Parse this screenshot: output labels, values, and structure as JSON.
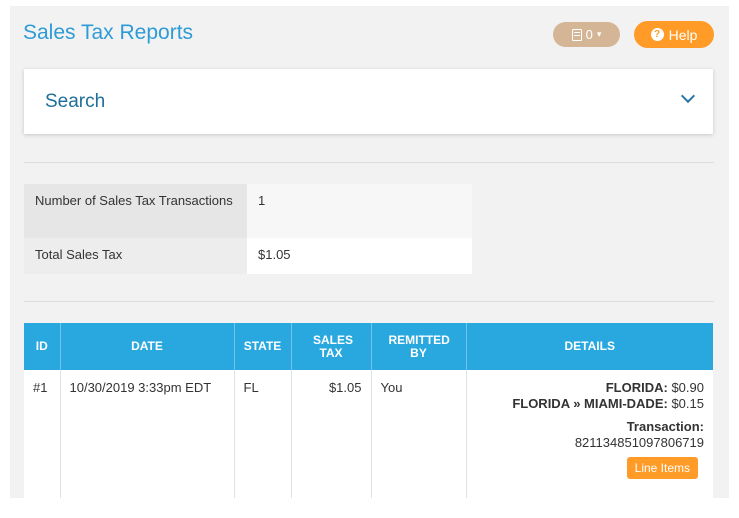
{
  "header": {
    "title": "Sales Tax Reports",
    "notifications_count": "0",
    "help_label": "Help"
  },
  "search": {
    "label": "Search"
  },
  "summary": {
    "rows": [
      {
        "label": "Number of Sales Tax Transactions",
        "value": "1"
      },
      {
        "label": "Total Sales Tax",
        "value": "$1.05"
      }
    ]
  },
  "table": {
    "headers": [
      "ID",
      "DATE",
      "STATE",
      "SALES TAX",
      "REMITTED BY",
      "DETAILS"
    ],
    "rows": [
      {
        "id": "#1",
        "date": "10/30/2019 3:33pm EDT",
        "state": "FL",
        "sales_tax": "$1.05",
        "remitted_by": "You",
        "details": {
          "lines": [
            {
              "jurisdiction": "FLORIDA:",
              "amount": "$0.90"
            },
            {
              "jurisdiction": "FLORIDA » MIAMI-DADE:",
              "amount": "$0.15"
            }
          ],
          "transaction_label": "Transaction:",
          "transaction_id": "821134851097806719",
          "line_items_label": "Line Items"
        }
      }
    ]
  },
  "colors": {
    "title": "#2d9bd6",
    "table_header": "#29a8e0",
    "orange": "#ff9b26",
    "notif_button": "#d4b595"
  }
}
